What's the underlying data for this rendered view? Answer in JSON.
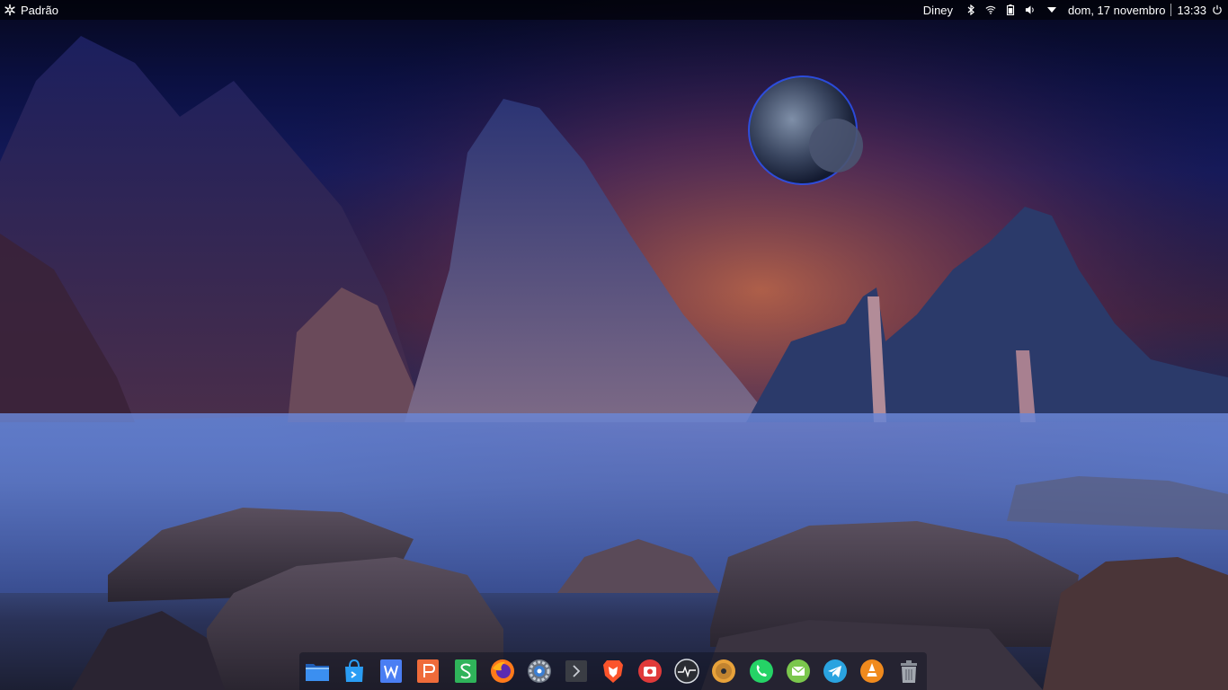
{
  "top_panel": {
    "workspace_label": "Padrão",
    "user_name": "Diney",
    "date": "dom, 17 novembro",
    "time": "13:33",
    "icons": [
      "menu-icon",
      "bluetooth-icon",
      "wifi-icon",
      "battery-icon",
      "volume-icon",
      "dropdown-arrow-icon",
      "power-icon"
    ]
  },
  "dock": {
    "apps": [
      {
        "name": "file-manager",
        "icon": "folder-icon",
        "color": "#2f7ee0"
      },
      {
        "name": "app-store",
        "icon": "store-icon",
        "color": "#2a9df4"
      },
      {
        "name": "wps-writer",
        "icon": "writer-icon",
        "color": "#4a7ef3"
      },
      {
        "name": "wps-presentation",
        "icon": "presentation-icon",
        "color": "#ef6b3a"
      },
      {
        "name": "wps-spreadsheets",
        "icon": "spreadsheet-icon",
        "color": "#2fb35a"
      },
      {
        "name": "firefox",
        "icon": "firefox-icon",
        "color": "#ff7a1a"
      },
      {
        "name": "settings",
        "icon": "settings-icon",
        "color": "#3b7fd4"
      },
      {
        "name": "terminal",
        "icon": "terminal-icon",
        "color": "#3a3d44"
      },
      {
        "name": "brave",
        "icon": "brave-icon",
        "color": "#fb542b"
      },
      {
        "name": "screenshot",
        "icon": "camera-icon",
        "color": "#e03a3a"
      },
      {
        "name": "system-monitor",
        "icon": "monitor-icon",
        "color": "#2b2d33"
      },
      {
        "name": "media-player",
        "icon": "disc-icon",
        "color": "#e8a23a"
      },
      {
        "name": "whatsapp",
        "icon": "whatsapp-icon",
        "color": "#25d366"
      },
      {
        "name": "email-client",
        "icon": "mail-icon",
        "color": "#7bc74d"
      },
      {
        "name": "telegram",
        "icon": "telegram-icon",
        "color": "#2aa3e0"
      },
      {
        "name": "vlc",
        "icon": "vlc-icon",
        "color": "#f08a1d"
      },
      {
        "name": "trash",
        "icon": "trash-icon",
        "color": "#8a8f98"
      }
    ]
  }
}
